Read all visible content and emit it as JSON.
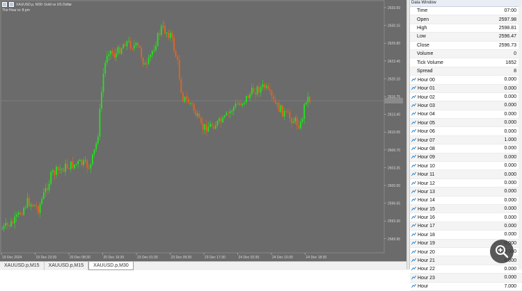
{
  "chart": {
    "symbol_line": "XAUUSD.p, M30:  Gold vs US Dollar",
    "indicator_line": "The Hour is: 8 pm",
    "price_labels": [
      "2633.50",
      "2630.15",
      "2626.80",
      "2623.45",
      "2620.10",
      "2616.75",
      "2613.40",
      "2610.05",
      "2606.70",
      "2603.35",
      "2600.00",
      "2596.65",
      "2593.30",
      "2589.95"
    ],
    "time_labels": [
      "19 Dec 2024",
      "19 Dec 23:30",
      "20 Dec 08:30",
      "20 Dec 16:30",
      "23 Dec 01:30",
      "23 Dec 09:30",
      "23 Dec 17:30",
      "24 Dec 02:30",
      "24 Dec 10:30",
      "24 Dec 18:30"
    ],
    "colors": {
      "background": "#6b6b6b",
      "bull": "#22e61c",
      "bear": "#e8631c",
      "grid": "#7b7b7b"
    }
  },
  "tabs": [
    {
      "label": "XAUUSD.p,M15"
    },
    {
      "label": "XAUUSD.p,M15"
    },
    {
      "label": "XAUUSD.p,M30"
    }
  ],
  "data_window": {
    "title": "Data Window",
    "rows": [
      {
        "label": "Time",
        "value": "07:00",
        "icon": ""
      },
      {
        "label": "Open",
        "value": "2597.98",
        "icon": ""
      },
      {
        "label": "High",
        "value": "2598.81",
        "icon": ""
      },
      {
        "label": "Low",
        "value": "2596.47",
        "icon": ""
      },
      {
        "label": "Close",
        "value": "2596.73",
        "icon": ""
      },
      {
        "label": "Volume",
        "value": "0",
        "icon": ""
      },
      {
        "label": "Tick Volume",
        "value": "1652",
        "icon": ""
      },
      {
        "label": "Spread",
        "value": "8",
        "icon": ""
      },
      {
        "label": "Hour 00",
        "value": "0.000",
        "icon": "indicator-icon"
      },
      {
        "label": "Hour 01",
        "value": "0.000",
        "icon": "indicator-icon"
      },
      {
        "label": "Hour 02",
        "value": "0.000",
        "icon": "indicator-icon"
      },
      {
        "label": "Hour 03",
        "value": "0.000",
        "icon": "indicator-icon"
      },
      {
        "label": "Hour 04",
        "value": "0.000",
        "icon": "indicator-icon"
      },
      {
        "label": "Hour 05",
        "value": "0.000",
        "icon": "indicator-icon"
      },
      {
        "label": "Hour 06",
        "value": "0.000",
        "icon": "indicator-icon"
      },
      {
        "label": "Hour 07",
        "value": "1.000",
        "icon": "indicator-icon"
      },
      {
        "label": "Hour 08",
        "value": "0.000",
        "icon": "indicator-icon"
      },
      {
        "label": "Hour 09",
        "value": "0.000",
        "icon": "indicator-icon"
      },
      {
        "label": "Hour 10",
        "value": "0.000",
        "icon": "indicator-icon"
      },
      {
        "label": "Hour 11",
        "value": "0.000",
        "icon": "indicator-icon"
      },
      {
        "label": "Hour 12",
        "value": "0.000",
        "icon": "indicator-icon"
      },
      {
        "label": "Hour 13",
        "value": "0.000",
        "icon": "indicator-icon"
      },
      {
        "label": "Hour 14",
        "value": "0.000",
        "icon": "indicator-icon"
      },
      {
        "label": "Hour 15",
        "value": "0.000",
        "icon": "indicator-icon"
      },
      {
        "label": "Hour 16",
        "value": "0.000",
        "icon": "indicator-icon"
      },
      {
        "label": "Hour 17",
        "value": "0.000",
        "icon": "indicator-icon"
      },
      {
        "label": "Hour 18",
        "value": "0.000",
        "icon": "indicator-icon"
      },
      {
        "label": "Hour 19",
        "value": "0.000",
        "icon": "indicator-icon"
      },
      {
        "label": "Hour 20",
        "value": "0.000",
        "icon": "indicator-icon"
      },
      {
        "label": "Hour 21",
        "value": "0.000",
        "icon": "indicator-icon"
      },
      {
        "label": "Hour 22",
        "value": "0.000",
        "icon": "indicator-icon"
      },
      {
        "label": "Hour 23",
        "value": "0.000",
        "icon": "indicator-icon"
      },
      {
        "label": "Hour",
        "value": "7.000",
        "icon": "indicator-icon"
      }
    ]
  }
}
